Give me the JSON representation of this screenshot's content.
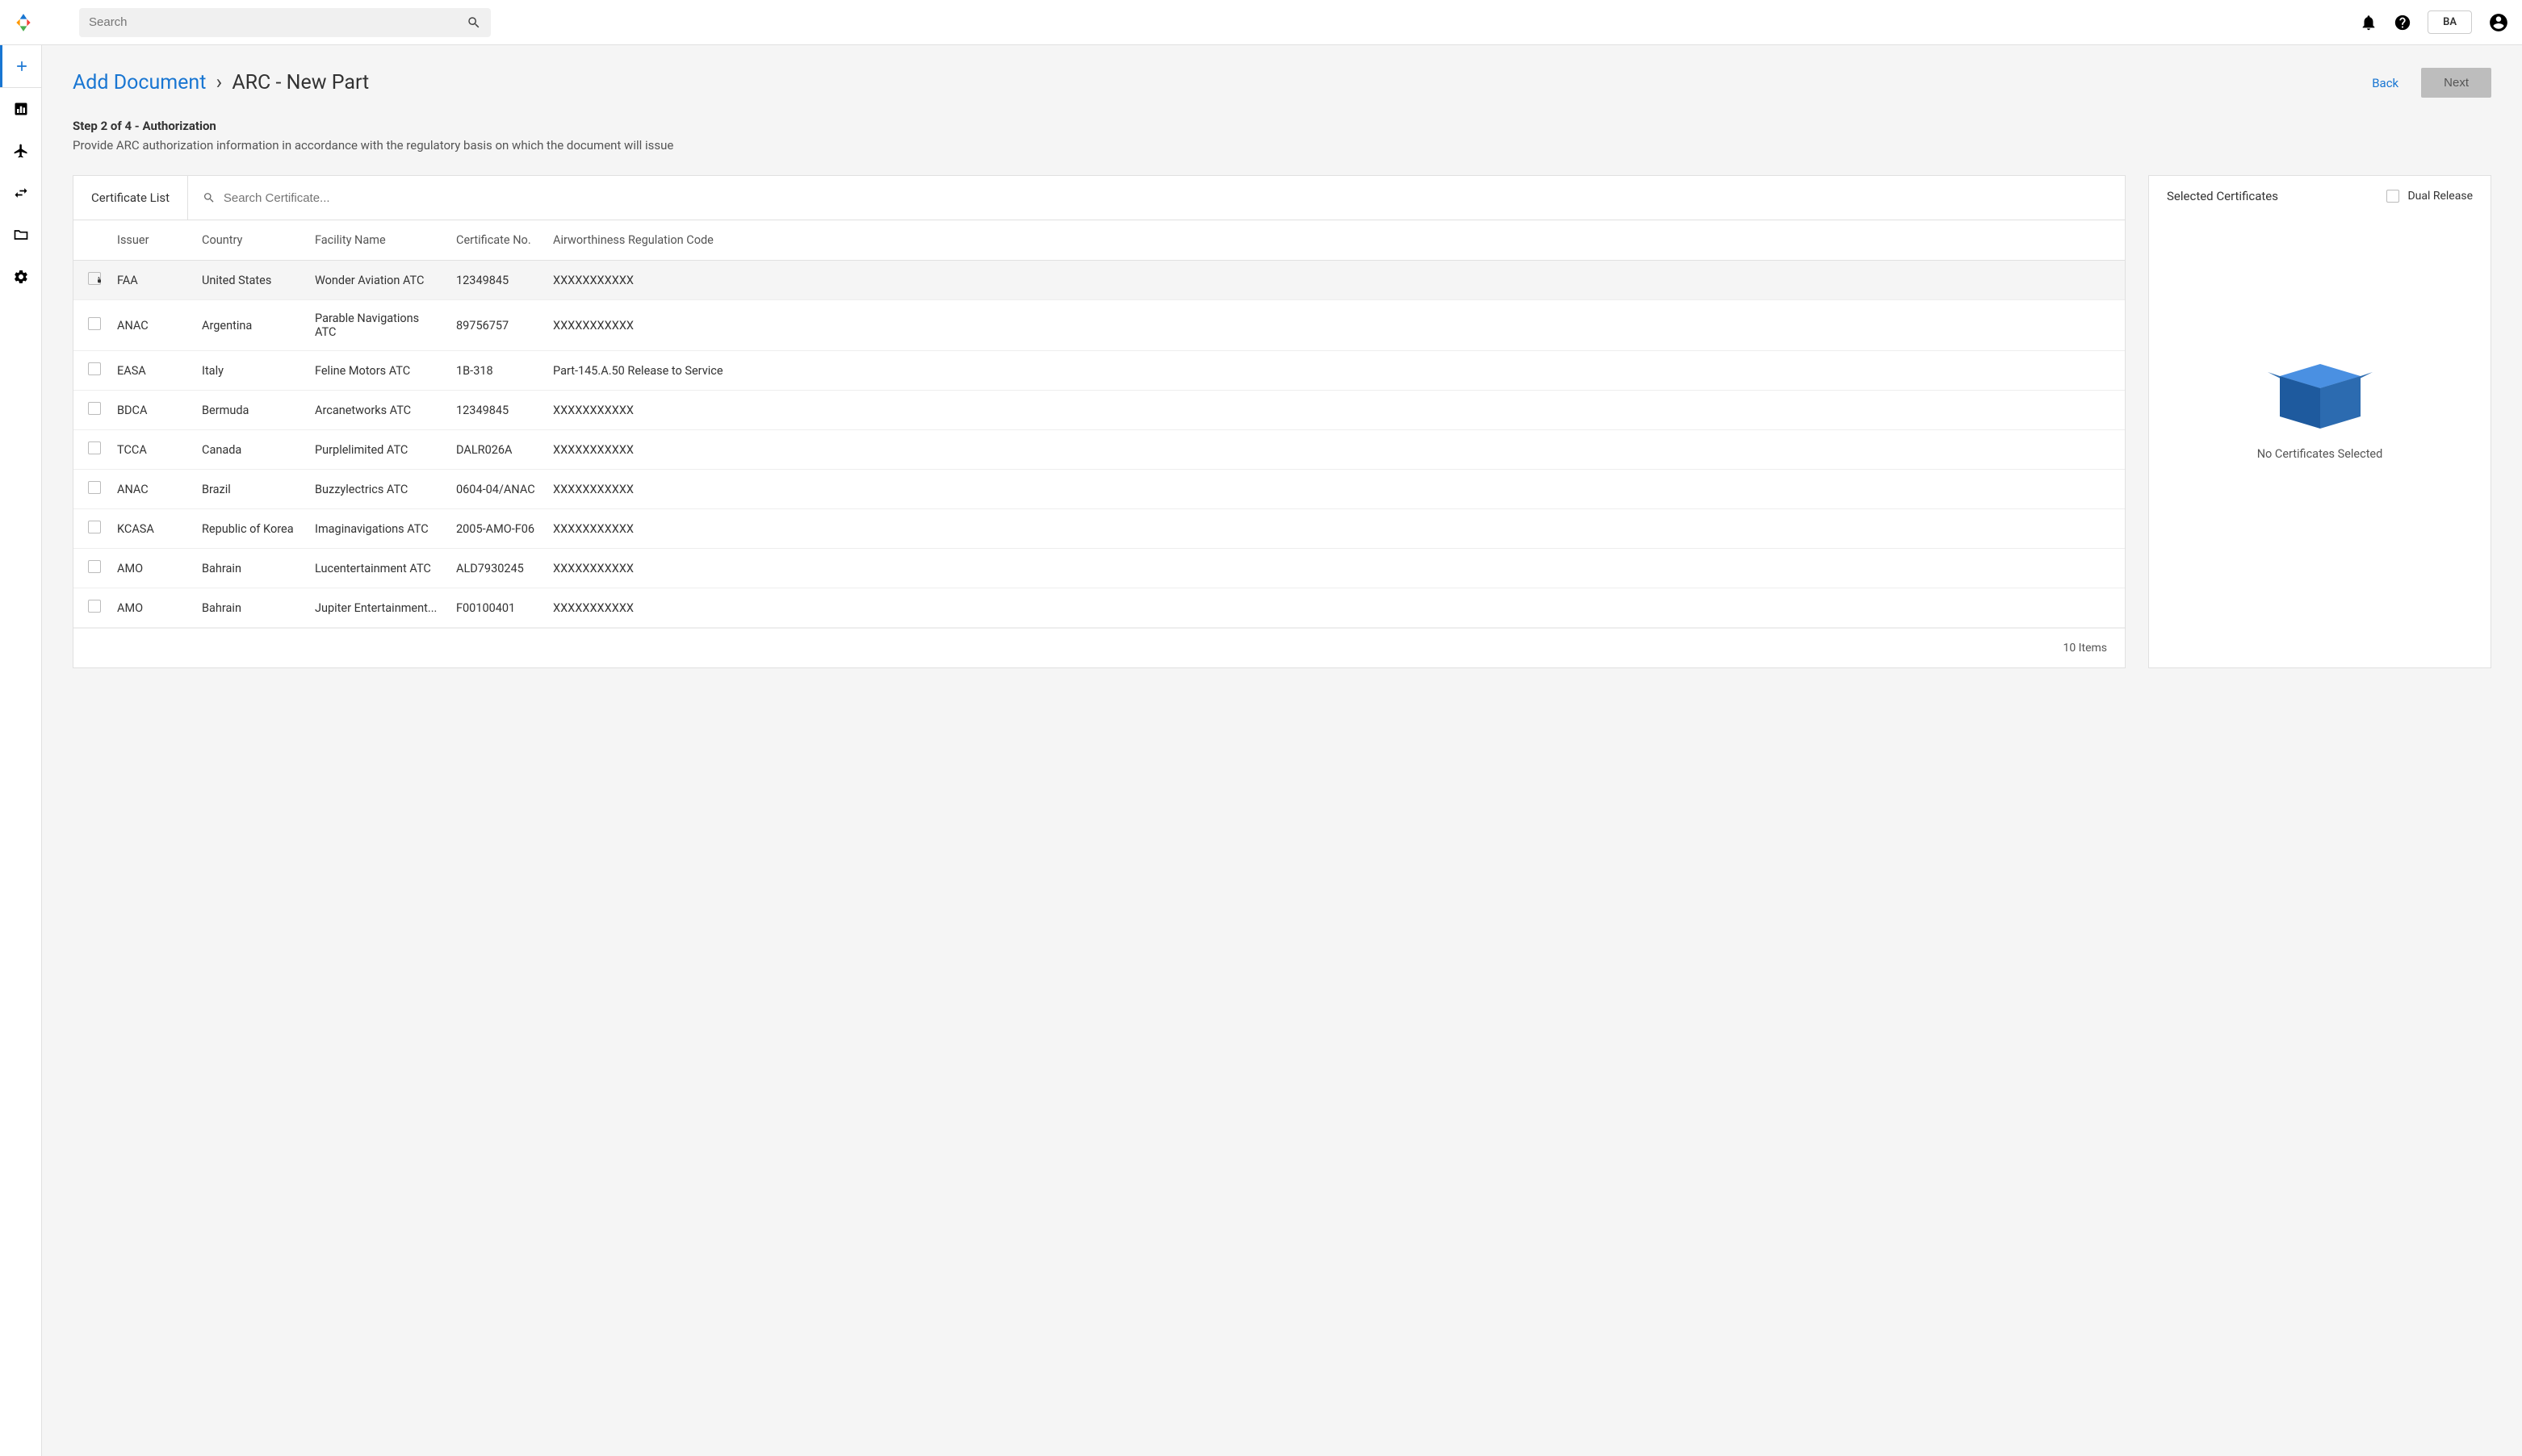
{
  "header": {
    "search_placeholder": "Search",
    "user_initials": "BA"
  },
  "breadcrumb": {
    "link": "Add Document",
    "current": "ARC - New Part"
  },
  "actions": {
    "back": "Back",
    "next": "Next"
  },
  "step": {
    "title": "Step 2 of 4 - Authorization",
    "description": "Provide ARC authorization information in accordance with the regulatory basis on which the document will issue"
  },
  "cert_list": {
    "tab_label": "Certificate List",
    "search_placeholder": "Search Certificate...",
    "columns": {
      "issuer": "Issuer",
      "country": "Country",
      "facility": "Facility Name",
      "cert_no": "Certificate No.",
      "reg_code": "Airworthiness Regulation Code"
    },
    "rows": [
      {
        "issuer": "FAA",
        "country": "United States",
        "facility": "Wonder Aviation ATC",
        "cert_no": "12349845",
        "reg_code": "XXXXXXXXXXX"
      },
      {
        "issuer": "ANAC",
        "country": "Argentina",
        "facility": "Parable Navigations ATC",
        "cert_no": "89756757",
        "reg_code": "XXXXXXXXXXX"
      },
      {
        "issuer": "EASA",
        "country": "Italy",
        "facility": "Feline Motors ATC",
        "cert_no": "1B-318",
        "reg_code": "Part-145.A.50 Release to Service"
      },
      {
        "issuer": "BDCA",
        "country": "Bermuda",
        "facility": "Arcanetworks ATC",
        "cert_no": "12349845",
        "reg_code": "XXXXXXXXXXX"
      },
      {
        "issuer": "TCCA",
        "country": "Canada",
        "facility": "Purplelimited ATC",
        "cert_no": "DALR026A",
        "reg_code": "XXXXXXXXXXX"
      },
      {
        "issuer": "ANAC",
        "country": "Brazil",
        "facility": "Buzzylectrics ATC",
        "cert_no": "0604-04/ANAC",
        "reg_code": "XXXXXXXXXXX"
      },
      {
        "issuer": "KCASA",
        "country": "Republic of Korea",
        "facility": "Imaginavigations ATC",
        "cert_no": "2005-AMO-F06",
        "reg_code": "XXXXXXXXXXX"
      },
      {
        "issuer": "AMO",
        "country": "Bahrain",
        "facility": "Lucentertainment ATC",
        "cert_no": "ALD7930245",
        "reg_code": "XXXXXXXXXXX"
      },
      {
        "issuer": "AMO",
        "country": "Bahrain",
        "facility": "Jupiter Entertainment...",
        "cert_no": "F00100401",
        "reg_code": "XXXXXXXXXXX"
      }
    ],
    "footer": "10 Items"
  },
  "selected": {
    "title": "Selected Certificates",
    "dual_release_label": "Dual Release",
    "empty_text": "No Certificates Selected"
  }
}
